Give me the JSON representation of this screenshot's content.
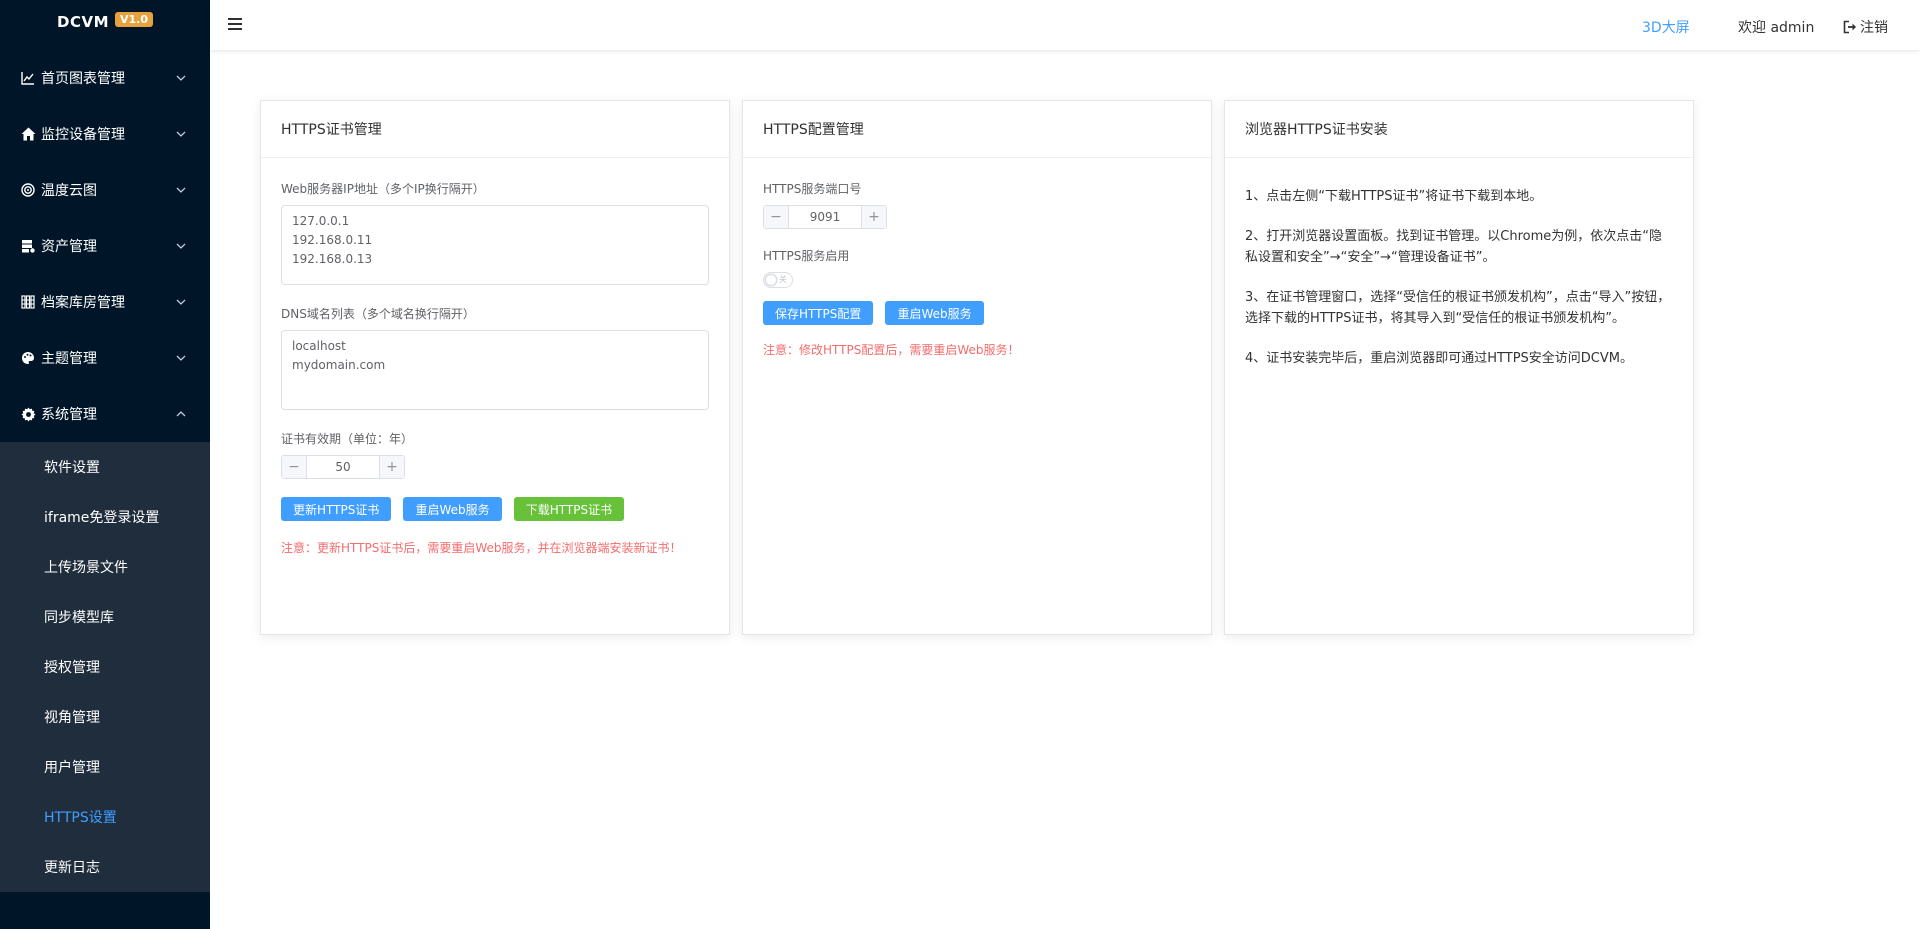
{
  "app": {
    "name": "DCVM",
    "version": "V1.0"
  },
  "header": {
    "screen3d": "3D大屏",
    "welcome": "欢迎 admin",
    "logout": "注销"
  },
  "menu": [
    {
      "label": "首页图表管理",
      "icon": "chart-line-icon",
      "expanded": false
    },
    {
      "label": "监控设备管理",
      "icon": "home-icon",
      "expanded": false
    },
    {
      "label": "温度云图",
      "icon": "target-icon",
      "expanded": false
    },
    {
      "label": "资产管理",
      "icon": "server-icon",
      "expanded": false
    },
    {
      "label": "档案库房管理",
      "icon": "grid-icon",
      "expanded": false
    },
    {
      "label": "主题管理",
      "icon": "palette-icon",
      "expanded": false
    },
    {
      "label": "系统管理",
      "icon": "gear-icon",
      "expanded": true
    }
  ],
  "submenu": [
    {
      "label": "软件设置",
      "active": false
    },
    {
      "label": "iframe免登录设置",
      "active": false
    },
    {
      "label": "上传场景文件",
      "active": false
    },
    {
      "label": "同步模型库",
      "active": false
    },
    {
      "label": "授权管理",
      "active": false
    },
    {
      "label": "视角管理",
      "active": false
    },
    {
      "label": "用户管理",
      "active": false
    },
    {
      "label": "HTTPS设置",
      "active": true
    },
    {
      "label": "更新日志",
      "active": false
    }
  ],
  "cert": {
    "title": "HTTPS证书管理",
    "ip_label": "Web服务器IP地址（多个IP换行隔开）",
    "ips": [
      "127.0.0.1",
      "192.168.0.11",
      "192.168.0.13"
    ],
    "dns_label": "DNS域名列表（多个域名换行隔开）",
    "dns": [
      "localhost",
      "mydomain.com"
    ],
    "validity_label": "证书有效期（单位：年）",
    "validity_value": "50",
    "btn_update": "更新HTTPS证书",
    "btn_restart": "重启Web服务",
    "btn_download": "下载HTTPS证书",
    "note": "注意：更新HTTPS证书后，需要重启Web服务，并在浏览器端安装新证书！"
  },
  "config": {
    "title": "HTTPS配置管理",
    "port_label": "HTTPS服务端口号",
    "port_value": "9091",
    "enable_label": "HTTPS服务启用",
    "toggle_text": "关",
    "toggle_on": false,
    "btn_save": "保存HTTPS配置",
    "btn_restart": "重启Web服务",
    "note": "注意：修改HTTPS配置后，需要重启Web服务！"
  },
  "install": {
    "title": "浏览器HTTPS证书安装",
    "step1": "1、点击左侧“下载HTTPS证书”将证书下载到本地。",
    "step2": "2、打开浏览器设置面板。找到证书管理。以Chrome为例，依次点击“隐私设置和安全”→“安全”→“管理设备证书”。",
    "step3": "3、在证书管理窗口，选择“受信任的根证书颁发机构”，点击“导入”按钮，选择下载的HTTPS证书，将其导入到“受信任的根证书颁发机构”。",
    "step4": "4、证书安装完毕后，重启浏览器即可通过HTTPS安全访问DCVM。"
  },
  "colors": {
    "sidebar": "#001528",
    "submenu": "#1f2d3d",
    "accent": "#409eff",
    "success": "#67c23a",
    "danger": "#f56c6c",
    "badge": "#e6a23c"
  }
}
